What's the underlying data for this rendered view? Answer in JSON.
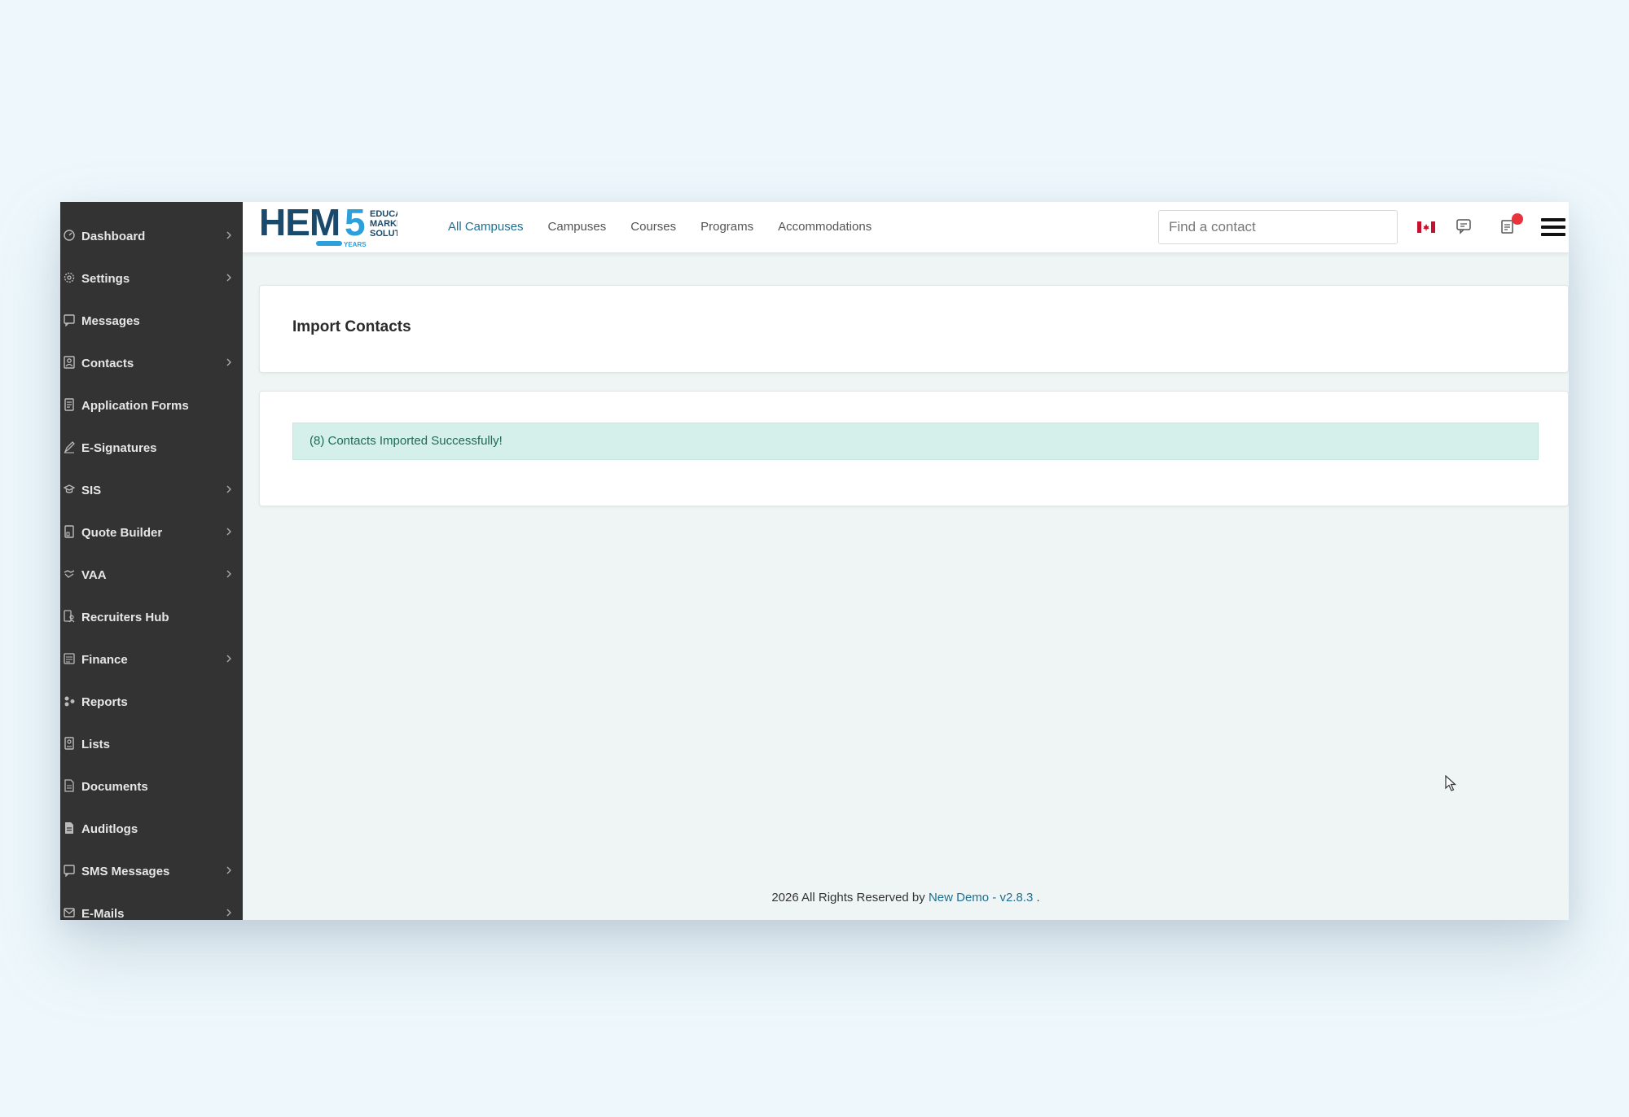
{
  "sidebar": {
    "items": [
      {
        "label": "Dashboard",
        "icon": "dashboard-icon",
        "has_chevron": true
      },
      {
        "label": "Settings",
        "icon": "gear-icon",
        "has_chevron": true
      },
      {
        "label": "Messages",
        "icon": "message-icon",
        "has_chevron": false
      },
      {
        "label": "Contacts",
        "icon": "contact-icon",
        "has_chevron": true
      },
      {
        "label": "Application Forms",
        "icon": "form-icon",
        "has_chevron": false
      },
      {
        "label": "E-Signatures",
        "icon": "pen-icon",
        "has_chevron": false
      },
      {
        "label": "SIS",
        "icon": "graduation-cap-icon",
        "has_chevron": true
      },
      {
        "label": "Quote Builder",
        "icon": "quote-icon",
        "has_chevron": true
      },
      {
        "label": "VAA",
        "icon": "handshake-icon",
        "has_chevron": true
      },
      {
        "label": "Recruiters Hub",
        "icon": "recruiter-icon",
        "has_chevron": false
      },
      {
        "label": "Finance",
        "icon": "finance-icon",
        "has_chevron": true
      },
      {
        "label": "Reports",
        "icon": "reports-icon",
        "has_chevron": false
      },
      {
        "label": "Lists",
        "icon": "list-icon",
        "has_chevron": false
      },
      {
        "label": "Documents",
        "icon": "document-icon",
        "has_chevron": false
      },
      {
        "label": "Auditlogs",
        "icon": "auditlog-icon",
        "has_chevron": false
      },
      {
        "label": "SMS Messages",
        "icon": "sms-icon",
        "has_chevron": true
      },
      {
        "label": "E-Mails",
        "icon": "mail-icon",
        "has_chevron": true
      }
    ]
  },
  "logo": {
    "main": "HEM5",
    "line1": "EDUCATION",
    "line2": "MARKETING",
    "line3": "SOLUTIONS",
    "years": "YEARS"
  },
  "nav": {
    "items": [
      {
        "label": "All Campuses",
        "active": true
      },
      {
        "label": "Campuses",
        "active": false
      },
      {
        "label": "Courses",
        "active": false
      },
      {
        "label": "Programs",
        "active": false
      },
      {
        "label": "Accommodations",
        "active": false
      }
    ]
  },
  "search": {
    "placeholder": "Find a contact"
  },
  "page": {
    "title": "Import Contacts"
  },
  "alert": {
    "message": "(8) Contacts Imported Successfully!"
  },
  "footer": {
    "text": "2026 All Rights Reserved by",
    "link": "New Demo - v2.8.3",
    "suffix": "."
  },
  "colors": {
    "sidebar": "#333333",
    "accent": "#1e6f93",
    "success_bg": "#d5f0ea",
    "badge": "#e8333c"
  }
}
